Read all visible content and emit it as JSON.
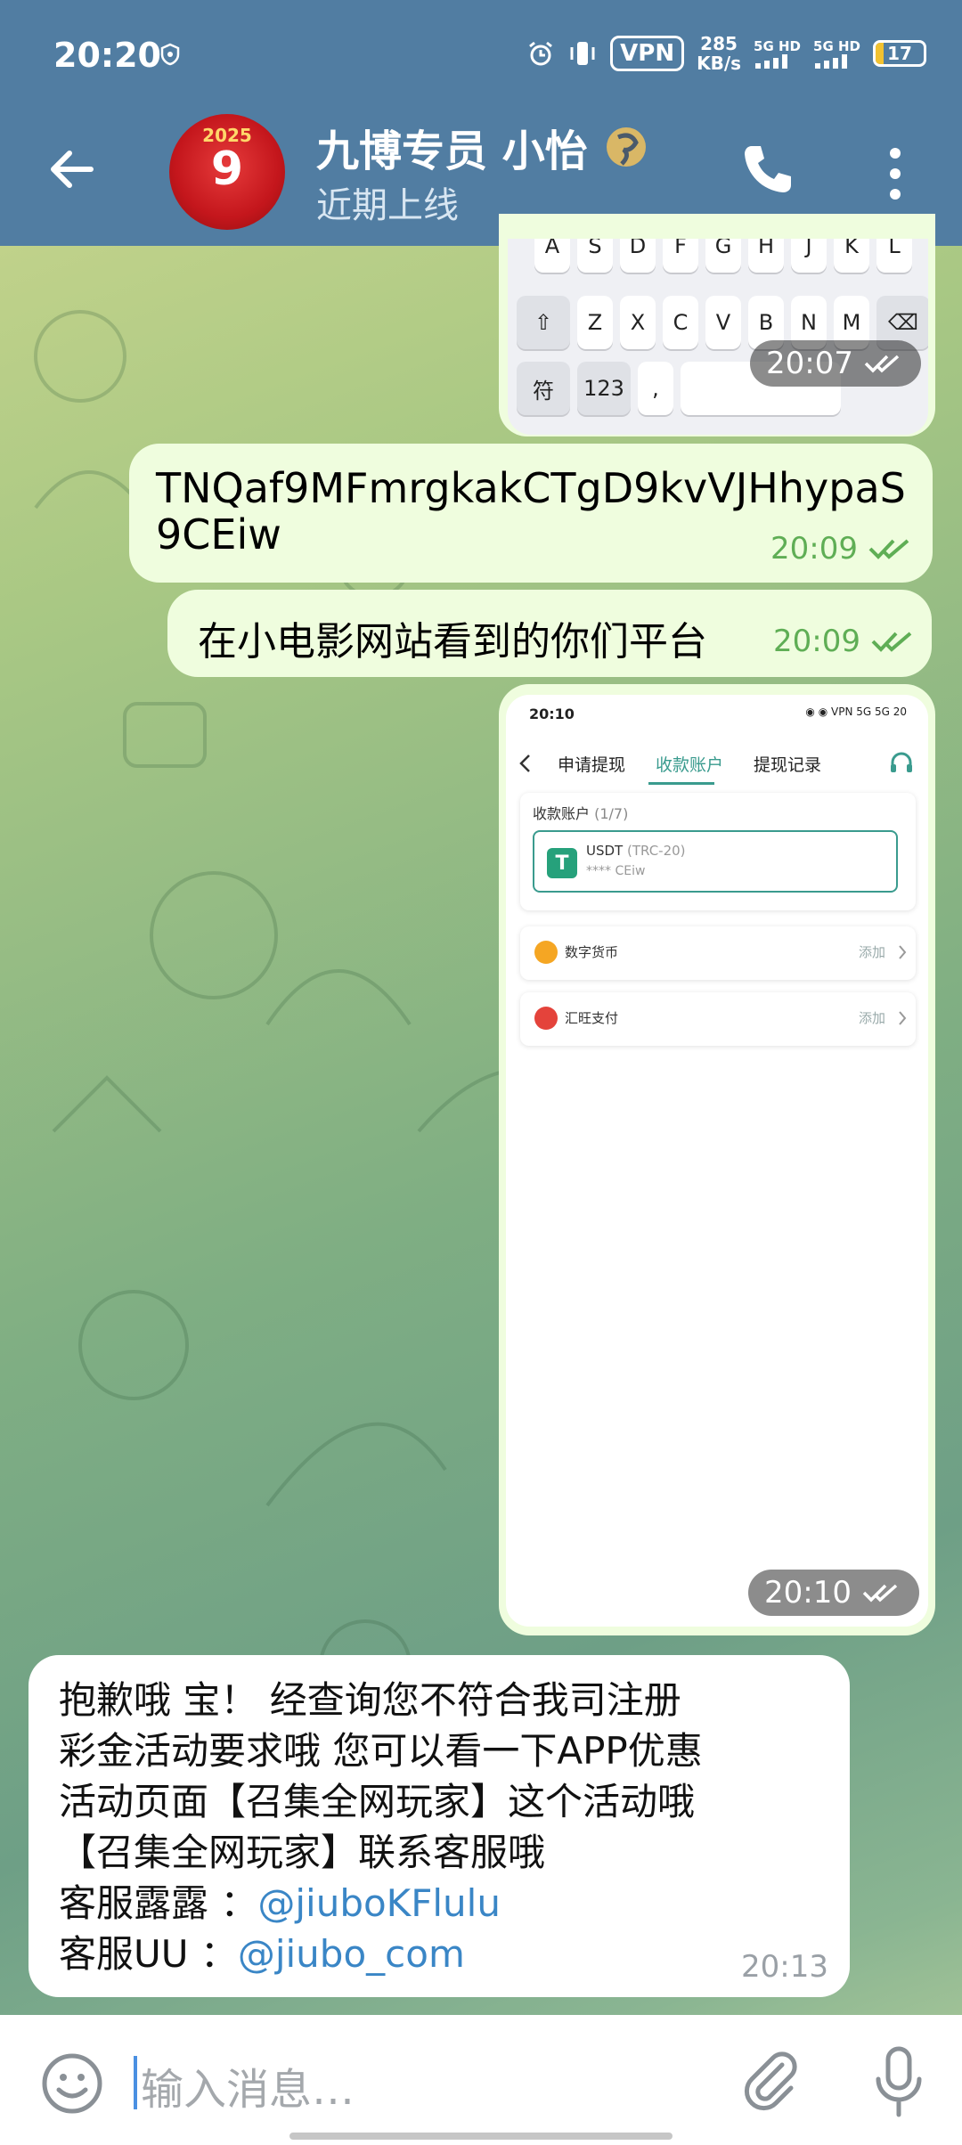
{
  "status_bar": {
    "time": "20:20",
    "vpn": "VPN",
    "speed_value": "285",
    "speed_unit": "KB/s",
    "net1_label": "5G HD",
    "net2_label": "5G HD",
    "battery": "17",
    "battery_level": 0.17
  },
  "header": {
    "contact_name": "九博专员 小怡",
    "presence": "近期上线",
    "avatar_year": "2025",
    "avatar_mark": "9"
  },
  "messages": {
    "keyboard_image": {
      "row1": [
        "A",
        "S",
        "D",
        "F",
        "G",
        "H",
        "J",
        "K",
        "L"
      ],
      "row2": [
        "Z",
        "X",
        "C",
        "V",
        "B",
        "N",
        "M"
      ],
      "sym_key": "符",
      "num_key": "123",
      "comma_key": ",",
      "time": "20:07"
    },
    "m1": {
      "text_line1": "TNQaf9MFmrgkakCTgD9kvVJHhypaS",
      "text_line2": "9CEiw",
      "time": "20:09"
    },
    "m2": {
      "text": "在小电影网站看到的你们平台",
      "time": "20:09"
    },
    "screenshot_image": {
      "status_time": "20:10",
      "status_right": "◉ ◉ VPN 5G 5G 20",
      "tab1": "申请提现",
      "tab2": "收款账户",
      "tab3": "提现记录",
      "accounts_label": "收款账户",
      "accounts_count": "(1/7)",
      "usdt_name": "USDT",
      "usdt_net": "(TRC-20)",
      "usdt_masked": "**** CEiw",
      "row1_label": "数字货币",
      "row1_action": "添加",
      "row2_label": "汇旺支付",
      "row2_action": "添加",
      "time": "20:10"
    },
    "m3": {
      "line1": "抱歉哦 宝！ 经查询您不符合我司注册",
      "line2": "彩金活动要求哦  您可以看一下APP优惠",
      "line3": "活动页面【召集全网玩家】这个活动哦",
      "line4": "【召集全网玩家】联系客服哦",
      "line5_label": "客服露露 ：",
      "line5_link": "@jiuboKFlulu",
      "line6_label": "客服UU    ：",
      "line6_link": "@jiubo_com",
      "time": "20:13"
    }
  },
  "input": {
    "placeholder": "输入消息…"
  },
  "colors": {
    "header": "#517da2",
    "out_bubble": "#effdde",
    "check": "#5fae55",
    "link": "#3a86c6"
  }
}
